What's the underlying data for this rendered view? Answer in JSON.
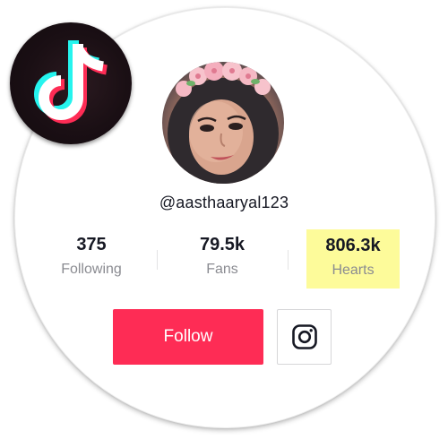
{
  "brand": {
    "logo_icon": "tiktok-logo-icon",
    "cyan": "#25f4ee",
    "red": "#fe2c55",
    "dark": "#161823"
  },
  "profile": {
    "username": "@aasthaaryal123",
    "avatar_icon": "profile-photo-with-flower-crown"
  },
  "stats": [
    {
      "value": "375",
      "label": "Following"
    },
    {
      "value": "79.5k",
      "label": "Fans"
    },
    {
      "value": "806.3k",
      "label": "Hearts",
      "highlight": "#fdfb9a"
    }
  ],
  "actions": {
    "follow_label": "Follow",
    "follow_color": "#fe2c55",
    "instagram_icon": "instagram-icon"
  }
}
